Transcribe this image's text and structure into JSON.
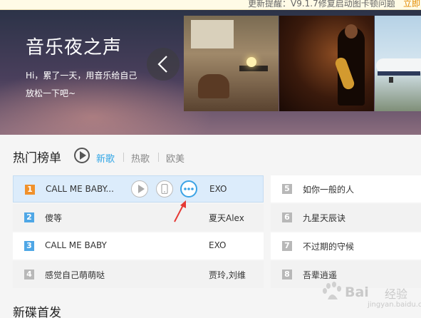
{
  "notice": {
    "text": "更新提醒：V9.1.7修复启动图卡顿问题",
    "link": "立即"
  },
  "banner": {
    "title": "音乐夜之声",
    "subtitle": "Hi，累了一天，用音乐给自己放松一下吧~"
  },
  "hot_chart": {
    "title": "热门榜单",
    "tabs": [
      {
        "label": "新歌",
        "selected": true
      },
      {
        "label": "热歌",
        "selected": false
      },
      {
        "label": "欧美",
        "selected": false
      }
    ],
    "left_rows": [
      {
        "rank": "1",
        "song": "CALL ME BABY...",
        "artist": "EXO",
        "active": true
      },
      {
        "rank": "2",
        "song": "傻等",
        "artist": "夏天Alex",
        "active": false
      },
      {
        "rank": "3",
        "song": "CALL ME BABY",
        "artist": "EXO",
        "active": false
      },
      {
        "rank": "4",
        "song": "感觉自己萌萌哒",
        "artist": "贾玲,刘维",
        "active": false
      }
    ],
    "right_rows": [
      {
        "rank": "5",
        "song": "如你一般的人"
      },
      {
        "rank": "6",
        "song": "九星天辰诀"
      },
      {
        "rank": "7",
        "song": "不过期的守候"
      },
      {
        "rank": "8",
        "song": "吾辈逍遥"
      }
    ]
  },
  "new_albums": {
    "title": "新碟首发"
  },
  "icons": {
    "prev": "chevron-left-icon",
    "play": "play-icon",
    "phone": "phone-icon",
    "more": "more-icon",
    "arrow": "red-arrow-icon"
  },
  "colors": {
    "accent": "#31a6e6",
    "rank_top": "#f0912b",
    "rank_mid": "#4fa7e6",
    "rank_low": "#b8b8b8",
    "active_row": "#dcecfb",
    "arrow": "#e53935"
  },
  "watermark": {
    "brand": "Bai",
    "brand2": "经验",
    "sub": "jingyan.baidu.com"
  }
}
